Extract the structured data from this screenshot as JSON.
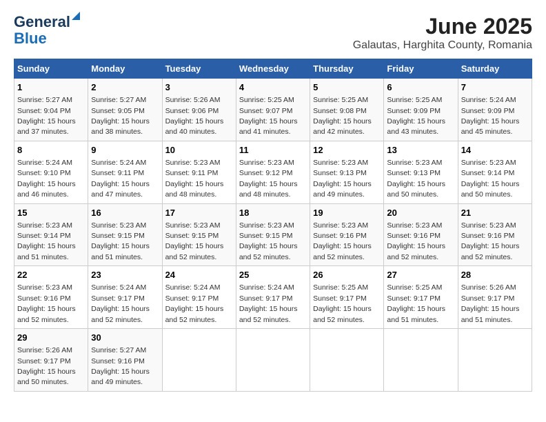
{
  "logo": {
    "line1": "General",
    "line2": "Blue"
  },
  "title": "June 2025",
  "subtitle": "Galautas, Harghita County, Romania",
  "days_header": [
    "Sunday",
    "Monday",
    "Tuesday",
    "Wednesday",
    "Thursday",
    "Friday",
    "Saturday"
  ],
  "weeks": [
    [
      {
        "day": "1",
        "sunrise": "5:27 AM",
        "sunset": "9:04 PM",
        "daylight": "15 hours and 37 minutes."
      },
      {
        "day": "2",
        "sunrise": "5:27 AM",
        "sunset": "9:05 PM",
        "daylight": "15 hours and 38 minutes."
      },
      {
        "day": "3",
        "sunrise": "5:26 AM",
        "sunset": "9:06 PM",
        "daylight": "15 hours and 40 minutes."
      },
      {
        "day": "4",
        "sunrise": "5:25 AM",
        "sunset": "9:07 PM",
        "daylight": "15 hours and 41 minutes."
      },
      {
        "day": "5",
        "sunrise": "5:25 AM",
        "sunset": "9:08 PM",
        "daylight": "15 hours and 42 minutes."
      },
      {
        "day": "6",
        "sunrise": "5:25 AM",
        "sunset": "9:09 PM",
        "daylight": "15 hours and 43 minutes."
      },
      {
        "day": "7",
        "sunrise": "5:24 AM",
        "sunset": "9:09 PM",
        "daylight": "15 hours and 45 minutes."
      }
    ],
    [
      {
        "day": "8",
        "sunrise": "5:24 AM",
        "sunset": "9:10 PM",
        "daylight": "15 hours and 46 minutes."
      },
      {
        "day": "9",
        "sunrise": "5:24 AM",
        "sunset": "9:11 PM",
        "daylight": "15 hours and 47 minutes."
      },
      {
        "day": "10",
        "sunrise": "5:23 AM",
        "sunset": "9:11 PM",
        "daylight": "15 hours and 48 minutes."
      },
      {
        "day": "11",
        "sunrise": "5:23 AM",
        "sunset": "9:12 PM",
        "daylight": "15 hours and 48 minutes."
      },
      {
        "day": "12",
        "sunrise": "5:23 AM",
        "sunset": "9:13 PM",
        "daylight": "15 hours and 49 minutes."
      },
      {
        "day": "13",
        "sunrise": "5:23 AM",
        "sunset": "9:13 PM",
        "daylight": "15 hours and 50 minutes."
      },
      {
        "day": "14",
        "sunrise": "5:23 AM",
        "sunset": "9:14 PM",
        "daylight": "15 hours and 50 minutes."
      }
    ],
    [
      {
        "day": "15",
        "sunrise": "5:23 AM",
        "sunset": "9:14 PM",
        "daylight": "15 hours and 51 minutes."
      },
      {
        "day": "16",
        "sunrise": "5:23 AM",
        "sunset": "9:15 PM",
        "daylight": "15 hours and 51 minutes."
      },
      {
        "day": "17",
        "sunrise": "5:23 AM",
        "sunset": "9:15 PM",
        "daylight": "15 hours and 52 minutes."
      },
      {
        "day": "18",
        "sunrise": "5:23 AM",
        "sunset": "9:15 PM",
        "daylight": "15 hours and 52 minutes."
      },
      {
        "day": "19",
        "sunrise": "5:23 AM",
        "sunset": "9:16 PM",
        "daylight": "15 hours and 52 minutes."
      },
      {
        "day": "20",
        "sunrise": "5:23 AM",
        "sunset": "9:16 PM",
        "daylight": "15 hours and 52 minutes."
      },
      {
        "day": "21",
        "sunrise": "5:23 AM",
        "sunset": "9:16 PM",
        "daylight": "15 hours and 52 minutes."
      }
    ],
    [
      {
        "day": "22",
        "sunrise": "5:23 AM",
        "sunset": "9:16 PM",
        "daylight": "15 hours and 52 minutes."
      },
      {
        "day": "23",
        "sunrise": "5:24 AM",
        "sunset": "9:17 PM",
        "daylight": "15 hours and 52 minutes."
      },
      {
        "day": "24",
        "sunrise": "5:24 AM",
        "sunset": "9:17 PM",
        "daylight": "15 hours and 52 minutes."
      },
      {
        "day": "25",
        "sunrise": "5:24 AM",
        "sunset": "9:17 PM",
        "daylight": "15 hours and 52 minutes."
      },
      {
        "day": "26",
        "sunrise": "5:25 AM",
        "sunset": "9:17 PM",
        "daylight": "15 hours and 52 minutes."
      },
      {
        "day": "27",
        "sunrise": "5:25 AM",
        "sunset": "9:17 PM",
        "daylight": "15 hours and 51 minutes."
      },
      {
        "day": "28",
        "sunrise": "5:26 AM",
        "sunset": "9:17 PM",
        "daylight": "15 hours and 51 minutes."
      }
    ],
    [
      {
        "day": "29",
        "sunrise": "5:26 AM",
        "sunset": "9:17 PM",
        "daylight": "15 hours and 50 minutes."
      },
      {
        "day": "30",
        "sunrise": "5:27 AM",
        "sunset": "9:16 PM",
        "daylight": "15 hours and 49 minutes."
      },
      null,
      null,
      null,
      null,
      null
    ]
  ]
}
